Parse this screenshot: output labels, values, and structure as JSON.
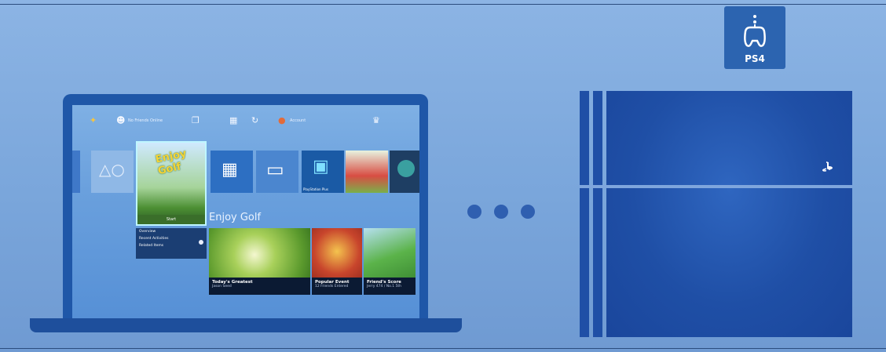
{
  "badge": {
    "label": "PS4",
    "icon": "controller-icon",
    "color": "#2c64b0"
  },
  "ps4_ui": {
    "topbar": [
      {
        "icon": "psplus-icon",
        "text": ""
      },
      {
        "icon": "friends-icon",
        "text": "No Friends Online"
      },
      {
        "icon": "messages-icon",
        "text": ""
      },
      {
        "icon": "notifications-icon",
        "text": ""
      },
      {
        "icon": "refresh-icon",
        "text": ""
      },
      {
        "icon": "profile-icon",
        "text": "Account"
      },
      {
        "icon": "trophy-icon",
        "text": ""
      }
    ],
    "tiles": [
      {
        "name": "library-tile",
        "label": ""
      },
      {
        "name": "psstore-tile",
        "label": ""
      },
      {
        "name": "enjoy-golf-tile",
        "label": "Start",
        "logo": "Enjoy Golf"
      },
      {
        "name": "tv-video-tile",
        "label": ""
      },
      {
        "name": "screen-tile",
        "label": ""
      },
      {
        "name": "playstation-plus-tile",
        "label": "PlayStation Plus"
      },
      {
        "name": "game-tile",
        "label": ""
      },
      {
        "name": "round-tile",
        "label": ""
      }
    ],
    "section_title": "Enjoy Golf",
    "menu": [
      "Overview",
      "Recent Activities",
      "Related Items"
    ],
    "cards": [
      {
        "title": "Today's Greatest",
        "subtitle": "Jason Seed"
      },
      {
        "title": "Popular Event",
        "subtitle": "12 Friends Entered"
      },
      {
        "title": "Friend's Score",
        "subtitle": "Jerry 474 / No.1 5th"
      }
    ]
  },
  "connection_dots": 3,
  "colors": {
    "background": "#7aa6dc",
    "device": "#1f57a8",
    "console": "#1f4fa6"
  }
}
